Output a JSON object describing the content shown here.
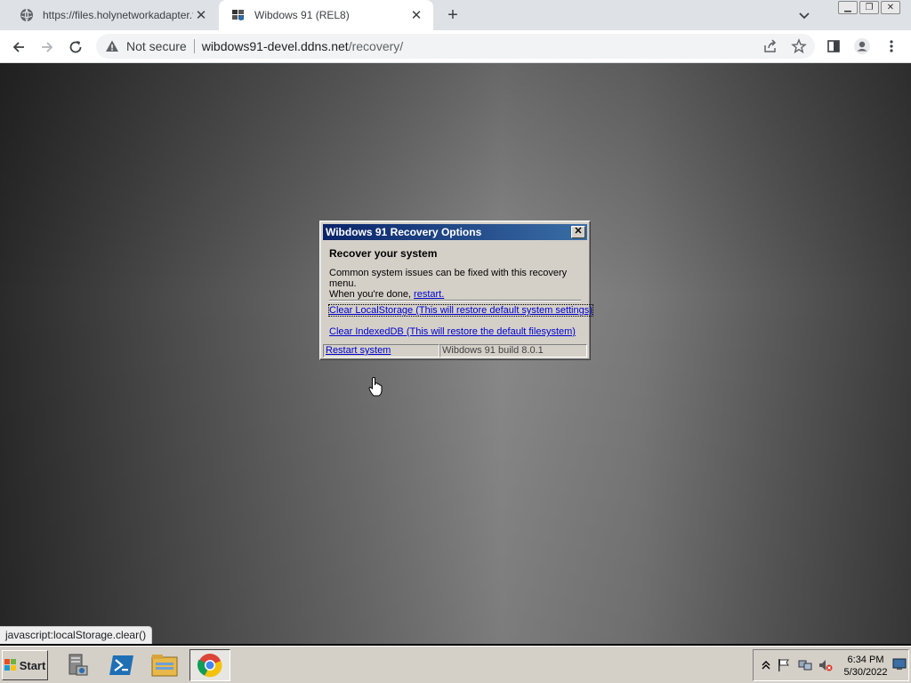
{
  "browser": {
    "tabs": [
      {
        "title": "https://files.holynetworkadapter.fun",
        "active": false
      },
      {
        "title": "Wibdows 91 (REL8)",
        "active": true
      }
    ],
    "new_tab": "+",
    "security_label": "Not secure",
    "url_host": "wibdows91-devel.ddns.net",
    "url_path": "/recovery/",
    "status_text": "javascript:localStorage.clear()"
  },
  "dialog": {
    "title": "Wibdows 91 Recovery Options",
    "close": "✕",
    "heading": "Recover your system",
    "body_line1": "Common system issues can be fixed with this recovery menu.",
    "body_line2": "When you're done, ",
    "restart_link": "restart.",
    "options": [
      {
        "label": "Clear LocalStorage (This will restore default system settings)"
      },
      {
        "label": "Clear IndexedDB (This will restore the default filesystem)"
      }
    ],
    "footer_link": "Restart system",
    "build": "Wibdows 91 build 8.0.1"
  },
  "taskbar": {
    "start_label": "Start",
    "apps": [
      "server-manager-icon",
      "powershell-icon",
      "file-explorer-icon",
      "chrome-icon"
    ],
    "time": "6:34 PM",
    "date": "5/30/2022"
  }
}
